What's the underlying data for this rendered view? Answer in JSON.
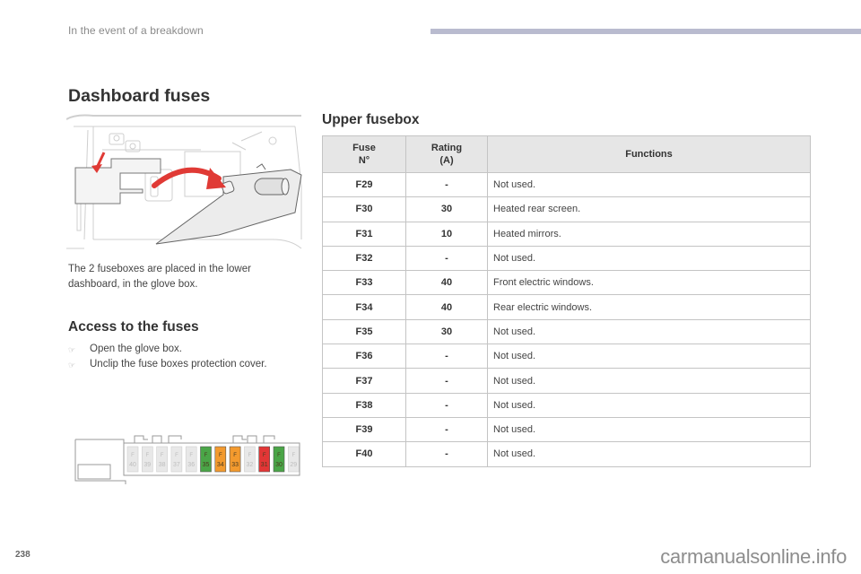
{
  "header": {
    "running_title": "In the event of a breakdown",
    "accent_bar_color": "#b9bbcf"
  },
  "page_title": "Dashboard fuses",
  "illustration": {
    "icon": "glove-box-cover-removal-illustration",
    "arrow_color": "#e03a35"
  },
  "intro_text": "The 2 fuseboxes are placed in the lower dashboard, in the glove box.",
  "access": {
    "title": "Access to the fuses",
    "bullet_icon": "pointing-hand-icon",
    "steps": [
      "Open the glove box.",
      "Unclip the fuse boxes protection cover."
    ]
  },
  "fusebox_diagram": {
    "fuses": [
      {
        "label": "F",
        "number": "40",
        "color": "#e8e8e8"
      },
      {
        "label": "F",
        "number": "39",
        "color": "#e8e8e8"
      },
      {
        "label": "F",
        "number": "38",
        "color": "#e8e8e8"
      },
      {
        "label": "F",
        "number": "37",
        "color": "#e8e8e8"
      },
      {
        "label": "F",
        "number": "36",
        "color": "#e8e8e8"
      },
      {
        "label": "F",
        "number": "35",
        "color": "#4aa547"
      },
      {
        "label": "F",
        "number": "34",
        "color": "#f39a2e"
      },
      {
        "label": "F",
        "number": "33",
        "color": "#f39a2e"
      },
      {
        "label": "F",
        "number": "32",
        "color": "#e8e8e8"
      },
      {
        "label": "F",
        "number": "31",
        "color": "#e23636"
      },
      {
        "label": "F",
        "number": "30",
        "color": "#4aa547"
      },
      {
        "label": "F",
        "number": "29",
        "color": "#e8e8e8"
      }
    ]
  },
  "upper_fusebox": {
    "title": "Upper fusebox",
    "columns": {
      "fuse_line1": "Fuse",
      "fuse_line2": "N°",
      "rating_line1": "Rating",
      "rating_line2": "(A)",
      "functions": "Functions"
    },
    "rows": [
      {
        "fuse": "F29",
        "rating": "-",
        "function": "Not used."
      },
      {
        "fuse": "F30",
        "rating": "30",
        "function": "Heated rear screen."
      },
      {
        "fuse": "F31",
        "rating": "10",
        "function": "Heated mirrors."
      },
      {
        "fuse": "F32",
        "rating": "-",
        "function": "Not used."
      },
      {
        "fuse": "F33",
        "rating": "40",
        "function": "Front electric windows."
      },
      {
        "fuse": "F34",
        "rating": "40",
        "function": "Rear electric windows."
      },
      {
        "fuse": "F35",
        "rating": "30",
        "function": "Not used."
      },
      {
        "fuse": "F36",
        "rating": "-",
        "function": "Not used."
      },
      {
        "fuse": "F37",
        "rating": "-",
        "function": "Not used."
      },
      {
        "fuse": "F38",
        "rating": "-",
        "function": "Not used."
      },
      {
        "fuse": "F39",
        "rating": "-",
        "function": "Not used."
      },
      {
        "fuse": "F40",
        "rating": "-",
        "function": "Not used."
      }
    ]
  },
  "footer": {
    "page_number": "238",
    "watermark": "carmanualsonline.info"
  }
}
